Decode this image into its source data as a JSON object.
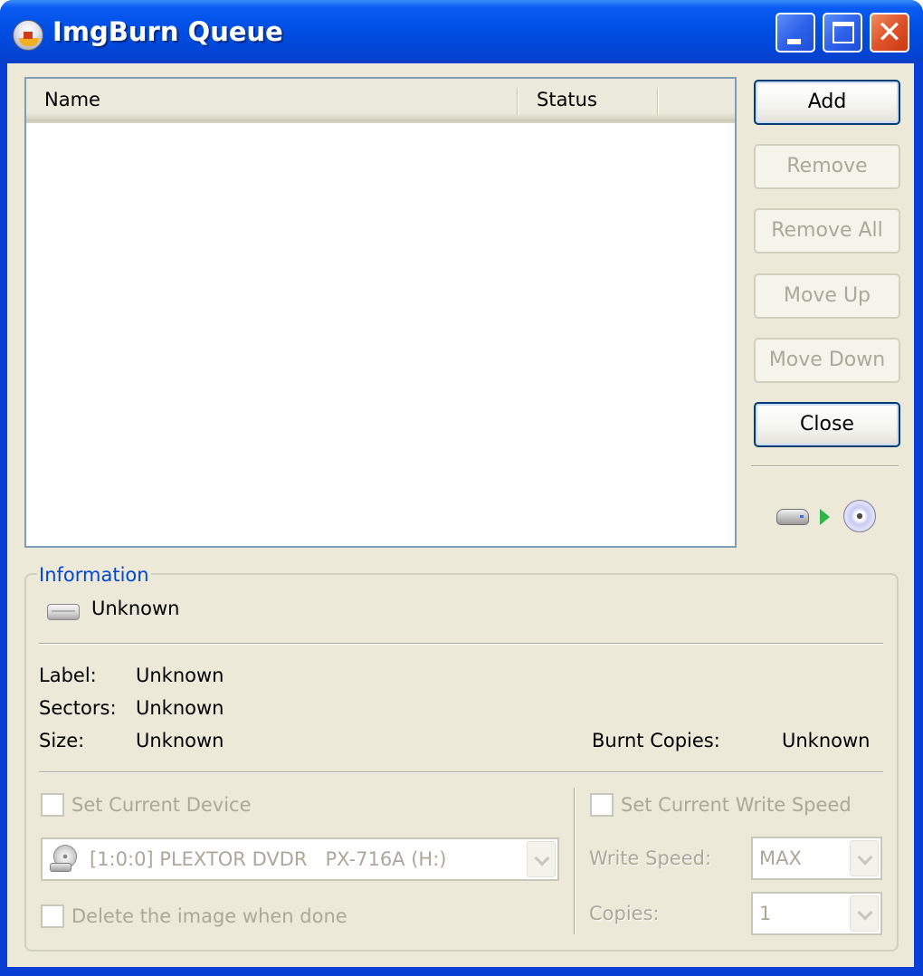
{
  "window": {
    "title": "ImgBurn Queue",
    "controls": {
      "minimize": "minimize",
      "maximize": "maximize",
      "close": "close"
    },
    "close_glyph": "✕"
  },
  "queue_list": {
    "columns": [
      {
        "label": "Name"
      },
      {
        "label": "Status"
      }
    ],
    "rows": []
  },
  "buttons": {
    "add": {
      "label": "Add",
      "enabled": true
    },
    "remove": {
      "label": "Remove",
      "enabled": false
    },
    "remove_all": {
      "label": "Remove All",
      "enabled": false
    },
    "move_up": {
      "label": "Move Up",
      "enabled": false
    },
    "move_down": {
      "label": "Move Down",
      "enabled": false
    },
    "close": {
      "label": "Close",
      "enabled": true
    }
  },
  "icons": {
    "burn_flow": [
      "drive-icon",
      "arrow-right-icon",
      "disc-icon"
    ]
  },
  "information": {
    "title": "Information",
    "image_name": "Unknown",
    "fields": [
      {
        "label": "Label:",
        "value": "Unknown"
      },
      {
        "label": "Sectors:",
        "value": "Unknown"
      },
      {
        "label": "Size:",
        "value": "Unknown"
      }
    ],
    "burnt_copies": {
      "label": "Burnt Copies:",
      "value": "Unknown"
    }
  },
  "options": {
    "set_current_device": {
      "label": "Set Current Device",
      "checked": false,
      "enabled": false
    },
    "device": {
      "value": "[1:0:0] PLEXTOR DVDR   PX-716A (H:)",
      "enabled": false
    },
    "delete_image": {
      "label": "Delete the image when done",
      "checked": false,
      "enabled": false
    },
    "set_current_write_speed": {
      "label": "Set Current Write Speed",
      "checked": false,
      "enabled": false
    },
    "write_speed": {
      "label": "Write Speed:",
      "value": "MAX",
      "enabled": false
    },
    "copies": {
      "label": "Copies:",
      "value": "1",
      "enabled": false
    }
  },
  "colors": {
    "titlebar": "#0054e3",
    "client_bg": "#ece9d8",
    "group_title": "#0046d5",
    "disabled_text": "#aca899",
    "close_button": "#e0532a"
  }
}
